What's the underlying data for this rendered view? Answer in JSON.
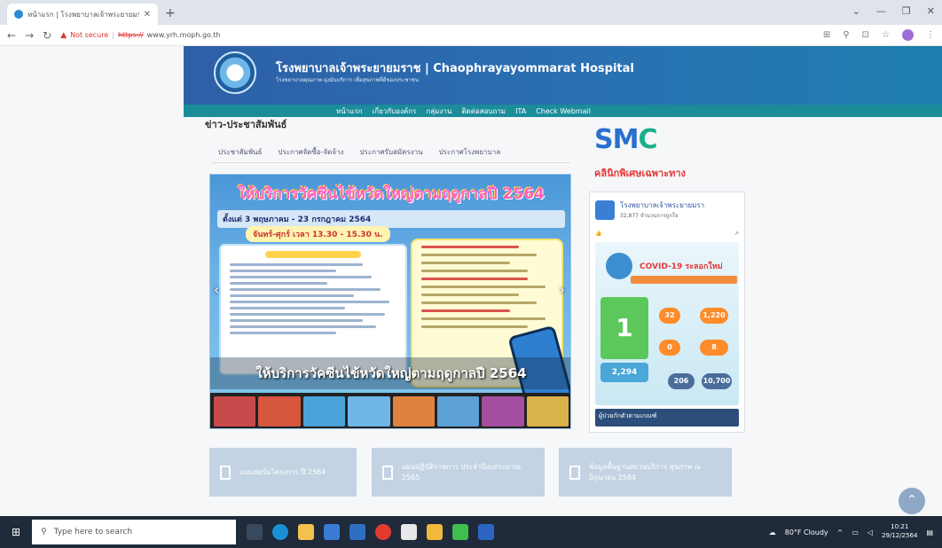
{
  "browser": {
    "tab_title": "หน้าแรก | โรงพยาบาลเจ้าพระยายมราช",
    "new_tab": "+",
    "not_secure": "Not secure",
    "url_scheme": "https://",
    "url_host": "www.yrh.moph.go.th"
  },
  "site": {
    "title": "โรงพยาบาลเจ้าพระยายมราช | Chaophrayayommarat Hospital",
    "subtitle": "โรงพยาบาลคุณภาพ มุ่งมั่นบริการ เพื่อสุขภาพที่ดีของประชาชน",
    "nav": [
      "หน้าแรก",
      "เกี่ยวกับองค์กร",
      "กลุ่มงาน",
      "ติดต่อสอบถาม",
      "ITA",
      "Check Webmail"
    ]
  },
  "news": {
    "heading": "ข่าว-ประชาสัมพันธ์",
    "tabs": [
      "ประชาสัมพันธ์",
      "ประกาศจัดซื้อ-จัดจ้าง",
      "ประกาศรับสมัครงาน",
      "ประกาศโรงพยาบาล"
    ]
  },
  "banner": {
    "title": "ให้บริการวัคซีนไข้หวัดใหญ่ตามฤดูกาลปี 2564",
    "dates": "ตั้งแต่ 3 พฤษภาคม - 23 กรกฎาคม 2564",
    "time": "จันทร์-ศุกร์ เวลา 13.30 - 15.30 น.",
    "caption": "ให้บริการวัคซีนไข้หวัดใหญ่ตามฤดูกาลปี 2564"
  },
  "right": {
    "smc_caption": "คลินิกพิเศษเฉพาะทาง",
    "fb_page": "โรงพยาบาลเจ้าพระยายมรา",
    "fb_likes": "32,877 จำนวนการถูกใจ",
    "covid_title": "COVID-19 ระลอกใหม่",
    "covid_new": "1",
    "covid_cumulative": "2,294",
    "stats": [
      "32",
      "1,220",
      "0",
      "8",
      "206",
      "10,700"
    ],
    "footer_text": "ผู้ป่วยกักตัวตามเกณฑ์"
  },
  "links": [
    "แบบฟอร์มโครงการ ปี 2564",
    "แผนปฏิบัติราชการ ประจำปีงบประมาณ 2565",
    "ข้อมูลพื้นฐานสถานบริการ สุขภาพ ณ มิถุนายน 2564"
  ],
  "taskbar": {
    "search_placeholder": "Type here to search",
    "weather": "80°F Cloudy",
    "time": "10:21",
    "date": "29/12/2564"
  },
  "colors": {
    "header": "#2d5fa6",
    "nav_bar": "#1b8c9a",
    "link_button": "#c3d3e3",
    "taskbar": "#1f2a3a"
  }
}
